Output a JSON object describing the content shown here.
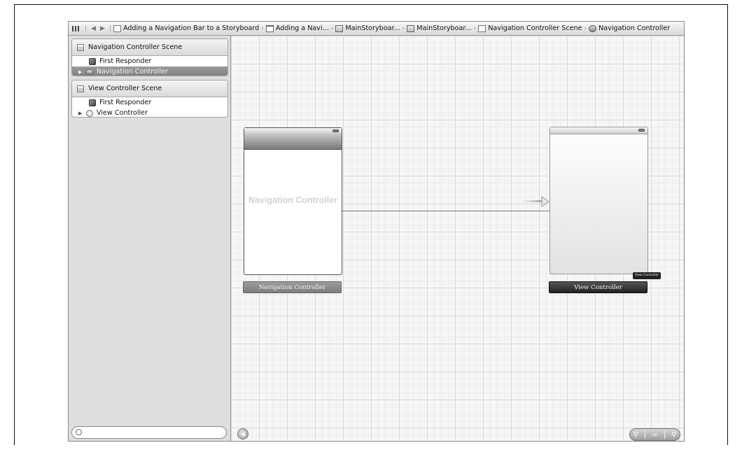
{
  "jumpbar": {
    "crumbs": [
      {
        "label": "Adding a Navigation Bar to a Storyboard",
        "icon": "project-icon"
      },
      {
        "label": "Adding a Navi...",
        "icon": "folder-icon"
      },
      {
        "label": "MainStoryboar...",
        "icon": "storyboard-file-icon"
      },
      {
        "label": "MainStoryboar...",
        "icon": "storyboard-file-icon"
      },
      {
        "label": "Navigation Controller Scene",
        "icon": "scene-icon"
      },
      {
        "label": "Navigation Controller",
        "icon": "navigation-controller-icon"
      }
    ]
  },
  "outline": {
    "scenes": [
      {
        "title": "Navigation Controller Scene",
        "items": [
          {
            "label": "First Responder",
            "selected": false
          },
          {
            "label": "Navigation Controller",
            "selected": true
          }
        ]
      },
      {
        "title": "View Controller Scene",
        "items": [
          {
            "label": "First Responder",
            "selected": false
          },
          {
            "label": "View Controller",
            "selected": false
          }
        ]
      }
    ],
    "filter_placeholder": ""
  },
  "canvas": {
    "nav_scene": {
      "watermark": "Navigation Controller",
      "label": "Navigation Controller"
    },
    "vc_scene": {
      "tooltip": "View Controller",
      "label": "View Controller"
    }
  },
  "colors": {
    "selection": "#8a8a8a",
    "vc_label_bg": "#333333",
    "nav_label_bg": "#8d8d8d"
  }
}
